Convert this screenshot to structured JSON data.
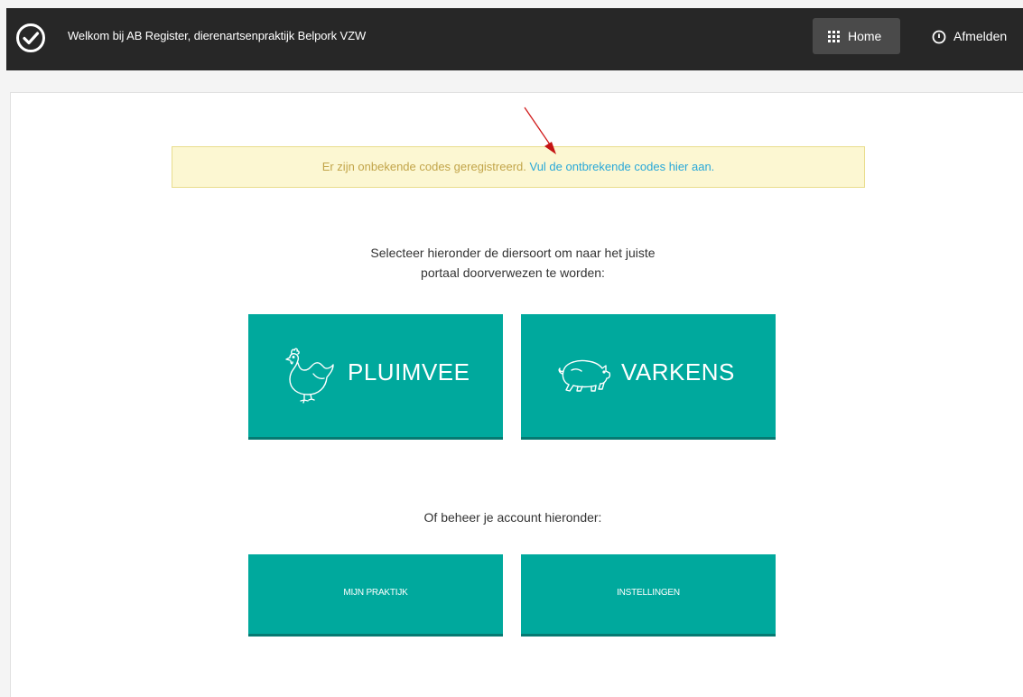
{
  "header": {
    "welcome_text": "Welkom bij AB Register, dierenartsenpraktijk Belpork VZW",
    "home_label": "Home",
    "logout_label": "Afmelden"
  },
  "alert": {
    "text": "Er zijn onbekende codes geregistreerd.",
    "link_text": "Vul de ontbrekende codes hier aan."
  },
  "intro": {
    "line1": "Selecteer hieronder de diersoort om naar het juiste",
    "line2": "portaal doorverwezen te worden:"
  },
  "species": [
    {
      "label": "PLUIMVEE",
      "icon": "chicken-icon"
    },
    {
      "label": "VARKENS",
      "icon": "pig-icon"
    }
  ],
  "account": {
    "heading": "Of beheer je account hieronder:",
    "buttons": [
      {
        "label": "MIJN PRAKTIJK"
      },
      {
        "label": "INSTELLINGEN"
      }
    ]
  },
  "colors": {
    "topbar": "#272727",
    "teal": "#00a99d",
    "alert_bg": "#fcf7d2",
    "link": "#29a8d8",
    "annotation_arrow": "#d11a1a"
  }
}
